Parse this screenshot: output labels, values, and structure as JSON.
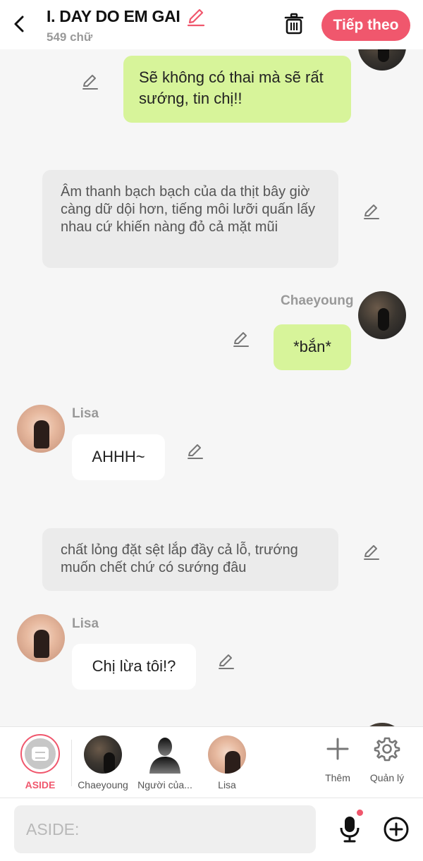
{
  "header": {
    "title": "I. DAY DO EM GAI",
    "word_count": "549 chữ",
    "next_label": "Tiếp theo"
  },
  "messages": [
    {
      "type": "outgoing",
      "text": "Sẽ không có thai mà sẽ rất sướng, tin chị!!"
    },
    {
      "type": "narration",
      "text": "Âm thanh bạch bạch của da thịt bây giờ càng dữ dội hơn, tiếng môi lưỡi quấn lấy nhau cứ khiến nàng đỏ cả mặt mũi"
    },
    {
      "type": "outgoing",
      "speaker": "Chaeyoung",
      "text": "*bắn*"
    },
    {
      "type": "incoming",
      "speaker": "Lisa",
      "text": "AHHH~"
    },
    {
      "type": "narration",
      "text": "chất lỏng đặt sệt lắp đầy cả lỗ, trướng muốn chết chứ có sướng đâu"
    },
    {
      "type": "incoming",
      "speaker": "Lisa",
      "text": "Chị lừa tôi!?"
    }
  ],
  "characters": {
    "aside": "ASIDE",
    "items": [
      "Chaeyoung",
      "Người của...",
      "Lisa"
    ],
    "add_label": "Thêm",
    "manage_label": "Quản lý"
  },
  "input": {
    "placeholder": "ASIDE:"
  },
  "colors": {
    "accent": "#f0576d",
    "outgoing_bubble": "#d7f49a",
    "narration_bubble": "#ebebeb"
  },
  "icons": [
    "back-icon",
    "pen-icon",
    "trash-icon",
    "edit-icon",
    "plus-icon",
    "gear-icon",
    "mic-icon",
    "add-circle-icon"
  ]
}
